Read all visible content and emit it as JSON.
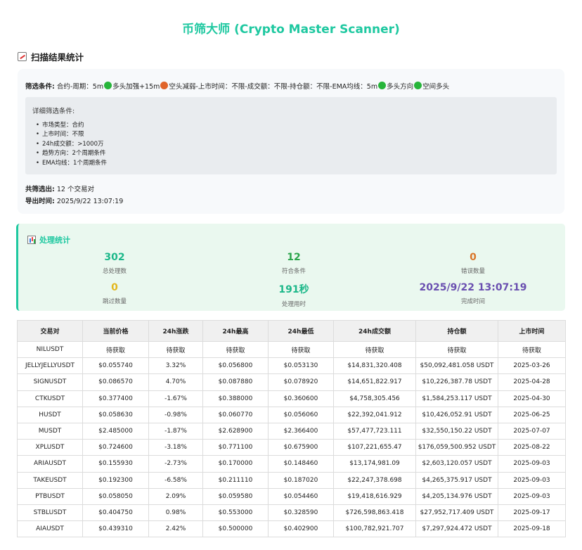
{
  "page": {
    "title": "币筛大师 (Crypto Master Scanner)"
  },
  "summary": {
    "heading": "扫描结果统计",
    "criteria_label": "筛选条件:",
    "criteria_part1": "合约-周期：5m",
    "criteria_part2": "多头加强+15m",
    "criteria_part3": "空头减弱-上市时间：不限-成交额：不限-持仓额：不限-EMA均线：5m",
    "criteria_part4": "多头方向",
    "criteria_part5": "空间多头",
    "detail_title": "详细筛选条件:",
    "details": [
      "市场类型：合约",
      "上市时间：不限",
      "24h成交额：>1000万",
      "趋势方向：2个周期条件",
      "EMA均线：1个周期条件"
    ],
    "total_label": "共筛选出:",
    "total_value": "12 个交易对",
    "export_label": "导出时间:",
    "export_value": "2025/9/22 13:07:19"
  },
  "stats": {
    "heading": "处理统计",
    "items": [
      {
        "value": "302",
        "label": "总处理数",
        "color": "#1db88a"
      },
      {
        "value": "12",
        "label": "符合条件",
        "color": "#2aa44a"
      },
      {
        "value": "0",
        "label": "错误数量",
        "color": "#d9762a"
      },
      {
        "value": "0",
        "label": "跳过数量",
        "color": "#e3b71e"
      },
      {
        "value": "191秒",
        "label": "处理用时",
        "color": "#1db88a"
      },
      {
        "value": "2025/9/22 13:07:19",
        "label": "完成时间",
        "color": "#6a4fb0"
      }
    ]
  },
  "table": {
    "headers": [
      "交易对",
      "当前价格",
      "24h涨跌",
      "24h最高",
      "24h最低",
      "24h成交额",
      "持仓额",
      "上市时间"
    ],
    "rows": [
      [
        "NILUSDT",
        "待获取",
        "待获取",
        "待获取",
        "待获取",
        "待获取",
        "待获取",
        "待获取"
      ],
      [
        "JELLYJELLYUSDT",
        "$0.055740",
        "3.32%",
        "$0.056800",
        "$0.053130",
        "$14,831,320.408",
        "$50,092,481.058 USDT",
        "2025-03-26"
      ],
      [
        "SIGNUSDT",
        "$0.086570",
        "4.70%",
        "$0.087880",
        "$0.078920",
        "$14,651,822.917",
        "$10,226,387.78 USDT",
        "2025-04-28"
      ],
      [
        "CTKUSDT",
        "$0.377400",
        "-1.67%",
        "$0.388000",
        "$0.360600",
        "$4,758,305.456",
        "$1,584,253.117 USDT",
        "2025-04-30"
      ],
      [
        "HUSDT",
        "$0.058630",
        "-0.98%",
        "$0.060770",
        "$0.056060",
        "$22,392,041.912",
        "$10,426,052.91 USDT",
        "2025-06-25"
      ],
      [
        "MUSDT",
        "$2.485000",
        "-1.87%",
        "$2.628900",
        "$2.366400",
        "$57,477,723.111",
        "$32,550,150.22 USDT",
        "2025-07-07"
      ],
      [
        "XPLUSDT",
        "$0.724600",
        "-3.18%",
        "$0.771100",
        "$0.675900",
        "$107,221,655.47",
        "$176,059,500.952 USDT",
        "2025-08-22"
      ],
      [
        "ARIAUSDT",
        "$0.155930",
        "-2.73%",
        "$0.170000",
        "$0.148460",
        "$13,174,981.09",
        "$2,603,120.057 USDT",
        "2025-09-03"
      ],
      [
        "TAKEUSDT",
        "$0.192300",
        "-6.58%",
        "$0.211110",
        "$0.187020",
        "$22,247,378.698",
        "$4,265,375.917 USDT",
        "2025-09-03"
      ],
      [
        "PTBUSDT",
        "$0.058050",
        "2.09%",
        "$0.059580",
        "$0.054460",
        "$19,418,616.929",
        "$4,205,134.976 USDT",
        "2025-09-03"
      ],
      [
        "STBLUSDT",
        "$0.404750",
        "0.98%",
        "$0.553000",
        "$0.328590",
        "$726,598,863.418",
        "$27,952,717.409 USDT",
        "2025-09-17"
      ],
      [
        "AIAUSDT",
        "$0.439310",
        "2.42%",
        "$0.500000",
        "$0.402900",
        "$100,782,921.707",
        "$7,297,924.472 USDT",
        "2025-09-18"
      ]
    ]
  }
}
